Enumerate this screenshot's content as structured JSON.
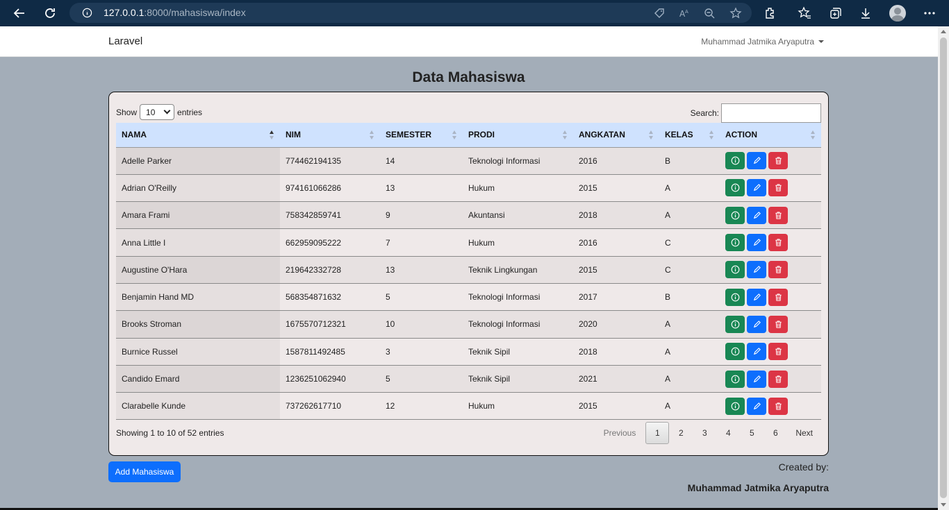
{
  "browser": {
    "url_host": "127.0.0.1",
    "url_rest": ":8000/mahasiswa/index"
  },
  "navbar": {
    "brand": "Laravel",
    "user": "Muhammad Jatmika Aryaputra"
  },
  "page_title": "Data Mahasiswa",
  "table_controls": {
    "show_label": "Show",
    "page_length": "10",
    "entries_label": "entries",
    "search_label": "Search:",
    "search_value": ""
  },
  "columns": [
    "NAMA",
    "NIM",
    "SEMESTER",
    "PRODI",
    "ANGKATAN",
    "KELAS",
    "ACTION"
  ],
  "rows": [
    {
      "nama": "Adelle Parker",
      "nim": "774462194135",
      "semester": "14",
      "prodi": "Teknologi Informasi",
      "angkatan": "2016",
      "kelas": "B"
    },
    {
      "nama": "Adrian O'Reilly",
      "nim": "974161066286",
      "semester": "13",
      "prodi": "Hukum",
      "angkatan": "2015",
      "kelas": "A"
    },
    {
      "nama": "Amara Frami",
      "nim": "758342859741",
      "semester": "9",
      "prodi": "Akuntansi",
      "angkatan": "2018",
      "kelas": "A"
    },
    {
      "nama": "Anna Little I",
      "nim": "662959095222",
      "semester": "7",
      "prodi": "Hukum",
      "angkatan": "2016",
      "kelas": "C"
    },
    {
      "nama": "Augustine O'Hara",
      "nim": "219642332728",
      "semester": "13",
      "prodi": "Teknik Lingkungan",
      "angkatan": "2015",
      "kelas": "C"
    },
    {
      "nama": "Benjamin Hand MD",
      "nim": "568354871632",
      "semester": "5",
      "prodi": "Teknologi Informasi",
      "angkatan": "2017",
      "kelas": "B"
    },
    {
      "nama": "Brooks Stroman",
      "nim": "1675570712321",
      "semester": "10",
      "prodi": "Teknologi Informasi",
      "angkatan": "2020",
      "kelas": "A"
    },
    {
      "nama": "Burnice Russel",
      "nim": "1587811492485",
      "semester": "3",
      "prodi": "Teknik Sipil",
      "angkatan": "2018",
      "kelas": "A"
    },
    {
      "nama": "Candido Emard",
      "nim": "1236251062940",
      "semester": "5",
      "prodi": "Teknik Sipil",
      "angkatan": "2021",
      "kelas": "A"
    },
    {
      "nama": "Clarabelle Kunde",
      "nim": "737262617710",
      "semester": "12",
      "prodi": "Hukum",
      "angkatan": "2015",
      "kelas": "A"
    }
  ],
  "footer_info": "Showing 1 to 10 of 52 entries",
  "pagination": {
    "previous": "Previous",
    "pages": [
      "1",
      "2",
      "3",
      "4",
      "5",
      "6"
    ],
    "current": "1",
    "next": "Next"
  },
  "add_button": "Add Mahasiswa",
  "created_by_label": "Created by:",
  "author": "Muhammad Jatmika Aryaputra",
  "icons": {
    "info": "info-circle-icon",
    "edit": "pencil-icon",
    "delete": "trash-icon"
  },
  "colors": {
    "info_button": "#198754",
    "edit_button": "#0d6efd",
    "delete_button": "#dc3545",
    "header_row": "#cfe2fe"
  }
}
